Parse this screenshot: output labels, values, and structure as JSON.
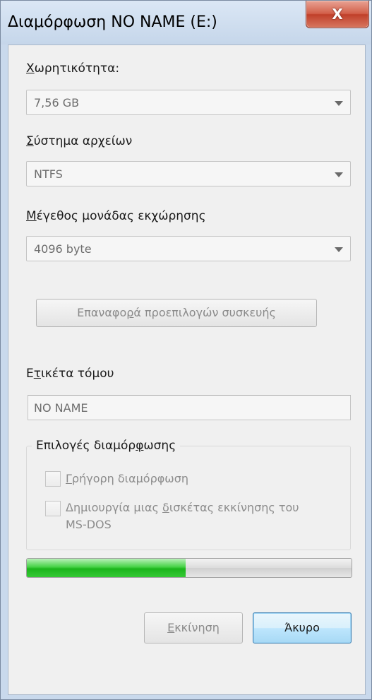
{
  "window": {
    "title": "Διαμόρφωση NO NAME (E:)",
    "close_label": "X"
  },
  "capacity": {
    "label_hotkey": "Χ",
    "label_rest": "ωρητικότητα:",
    "value": "7,56 GB"
  },
  "file_system": {
    "label_hotkey": "Σ",
    "label_rest": "ύστημα αρχείων",
    "value": "NTFS"
  },
  "allocation": {
    "label_hotkey": "Μ",
    "label_rest": "έγεθος μονάδας εκχώρησης",
    "value": "4096 byte"
  },
  "restore_defaults": {
    "part1": "Επαναφο",
    "hotkey": "ρ",
    "part2": "ά προεπιλογών συσκευής"
  },
  "volume_label": {
    "part1": "Ε",
    "hotkey": "τ",
    "part2": "ικέτα τόμου",
    "value": "NO NAME"
  },
  "format_options": {
    "title_part1": "Επιλογές διαμόρ",
    "title_hotkey": "φ",
    "title_part2": "ωσης",
    "quick_format": {
      "hotkey": "Γ",
      "rest": "ρήγορη διαμόρφωση",
      "checked": false
    },
    "msdos_disk": {
      "part1": "Δημιουργία μιας ",
      "hotkey": "δ",
      "part2": "ισκέτας εκκίνησης του",
      "line2": "MS-DOS",
      "checked": false
    }
  },
  "progress": {
    "value_percent": 49,
    "fill_color": "#2cc32c"
  },
  "buttons": {
    "start_hotkey": "Ε",
    "start_rest": "κκίνηση",
    "cancel": "Άκυρο"
  }
}
